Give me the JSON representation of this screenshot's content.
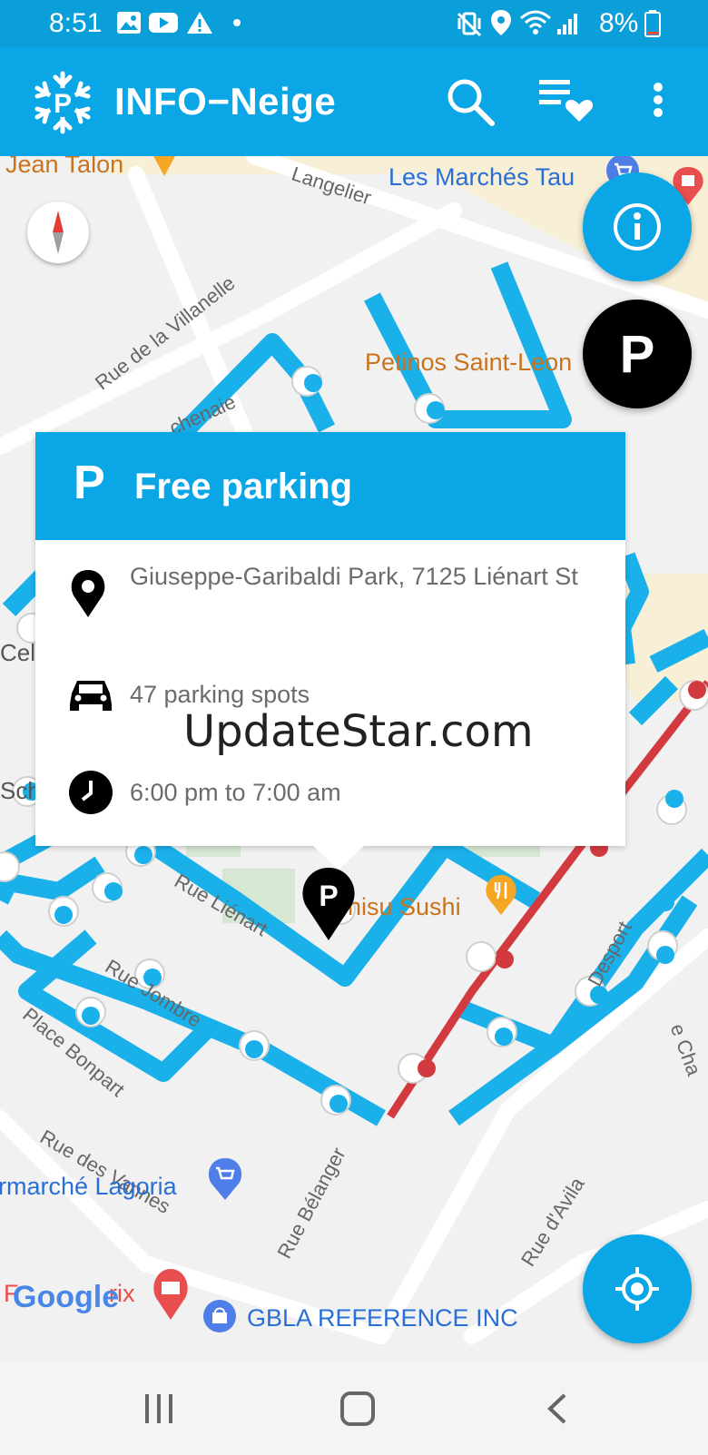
{
  "status_bar": {
    "time": "8:51",
    "battery": "8%",
    "icons": [
      "image-icon",
      "youtube-icon",
      "warning-icon",
      "dot-icon",
      "vibrate-icon",
      "location-icon",
      "wifi-icon",
      "signal-icon",
      "battery-icon"
    ]
  },
  "app_bar": {
    "title": "INFO−Neige",
    "logo_icon": "snowflake-p-icon",
    "actions": [
      "search-icon",
      "favorites-list-icon",
      "more-vert-icon"
    ]
  },
  "map": {
    "places": {
      "jean_talon": "Jean Talon",
      "les_marches": "Les Marchés Tau",
      "petinos": "Petinos Saint-Leon",
      "sushi": "hisu Sushi",
      "lagoria": "rmarché Lagoria",
      "gbla": "GBLA REFERENCE INC",
      "pharmacy": "F",
      "pharmacy2": "rix"
    },
    "streets": {
      "langelier": "Langelier",
      "villanelle": "Rue de la Villanelle",
      "chenaie": "chenaie",
      "lienart": "Rue Liénart",
      "jombre": "Rue Jombre",
      "bonpart": "Place Bonpart",
      "vannes": "Rue des Vannes",
      "belanger": "Rue Bélanger",
      "avila": "Rue d'Avila",
      "desport": "Desport",
      "cel": "Cel",
      "sch": "Sch",
      "cha": "e Cha"
    },
    "google_logo": "Google",
    "marker_letter": "P",
    "colors": {
      "free_parking_street": "#1ab0ea",
      "restricted_street": "#d23a3f",
      "accent": "#0aa6e6"
    }
  },
  "fab": {
    "info_icon": "info-icon",
    "parking_label": "P",
    "location_icon": "my-location-icon"
  },
  "card": {
    "header_letter": "P",
    "title": "Free parking",
    "address": "Giuseppe-Garibaldi Park, 7125  Liénart St",
    "spots": "47 parking spots",
    "hours": "6:00 pm to 7:00 am"
  },
  "watermark": "UpdateStar.com",
  "nav": {
    "recents_icon": "recents-icon",
    "home_icon": "home-icon",
    "back_icon": "back-icon"
  }
}
